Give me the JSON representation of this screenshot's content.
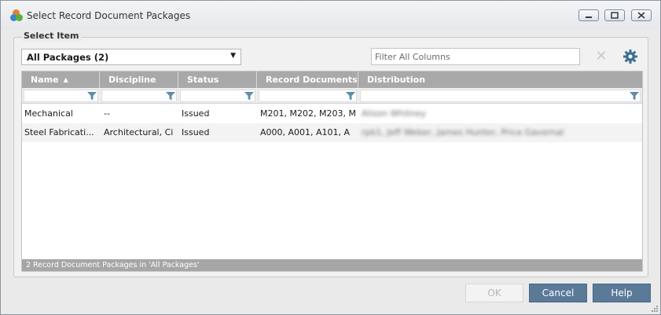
{
  "window": {
    "title": "Select Record Document Packages",
    "controls": [
      "minimize",
      "maximize",
      "close"
    ]
  },
  "group": {
    "label": "Select Item"
  },
  "package_select": {
    "value": "All Packages (2)"
  },
  "filter": {
    "placeholder": "Filter All Columns",
    "value": ""
  },
  "grid": {
    "columns": [
      "Name",
      "Discipline",
      "Status",
      "Record Documents",
      "Distribution"
    ],
    "sorted_column": "Name",
    "sort_direction": "ascending",
    "rows": [
      {
        "name": "Mechanical",
        "discipline": "--",
        "status": "Issued",
        "record_documents": "M201, M202, M203, M",
        "distribution": "Alison Whitney"
      },
      {
        "name": "Steel Fabricati...",
        "discipline": "Architectural, Ci",
        "status": "Issued",
        "record_documents": "A000, A001, A101, A",
        "distribution": "rpb1, Jeff Weber, James Hunter, Price Gavernal"
      }
    ],
    "footer": "2 Record Document Packages in 'All Packages'"
  },
  "buttons": {
    "ok": "OK",
    "cancel": "Cancel",
    "help": "Help"
  },
  "colors": {
    "header_bg": "#a9a9a9",
    "button_bg": "#5a7a98",
    "funnel": "#5f8fa8"
  }
}
